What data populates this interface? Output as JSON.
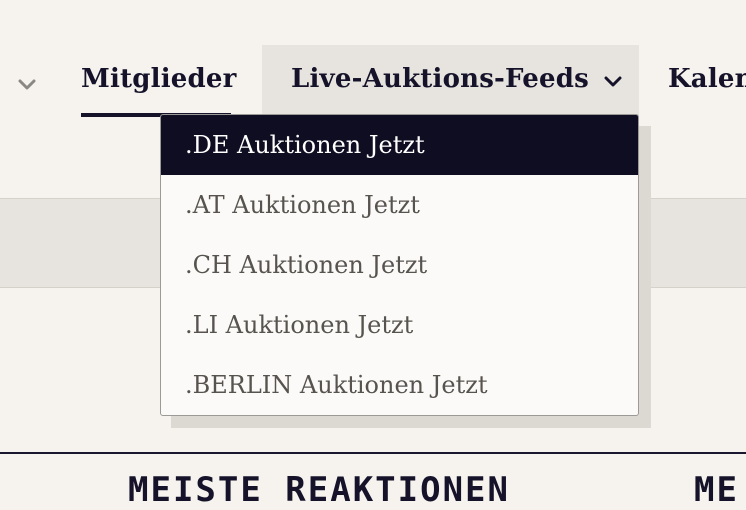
{
  "nav": {
    "items": [
      {
        "label": "Mitglieder"
      },
      {
        "label": "Live-Auktions-Feeds"
      },
      {
        "label": "Kalen"
      }
    ]
  },
  "dropdown": {
    "items": [
      {
        "label": ".DE Auktionen Jetzt",
        "active": true
      },
      {
        "label": ".AT Auktionen Jetzt",
        "active": false
      },
      {
        "label": ".CH Auktionen Jetzt",
        "active": false
      },
      {
        "label": ".LI Auktionen Jetzt",
        "active": false
      },
      {
        "label": ".BERLIN Auktionen Jetzt",
        "active": false
      }
    ]
  },
  "sections": {
    "headings": [
      {
        "label": "MEISTE REAKTIONEN"
      },
      {
        "label": "ME"
      }
    ]
  },
  "colors": {
    "background": "#f6f3ee",
    "active_item_bg": "#0f0d22",
    "text_dark": "#15122a",
    "text_muted": "#57534e"
  },
  "icons": {
    "nav_left": "chevron-down-icon",
    "nav_live": "chevron-down-icon"
  }
}
